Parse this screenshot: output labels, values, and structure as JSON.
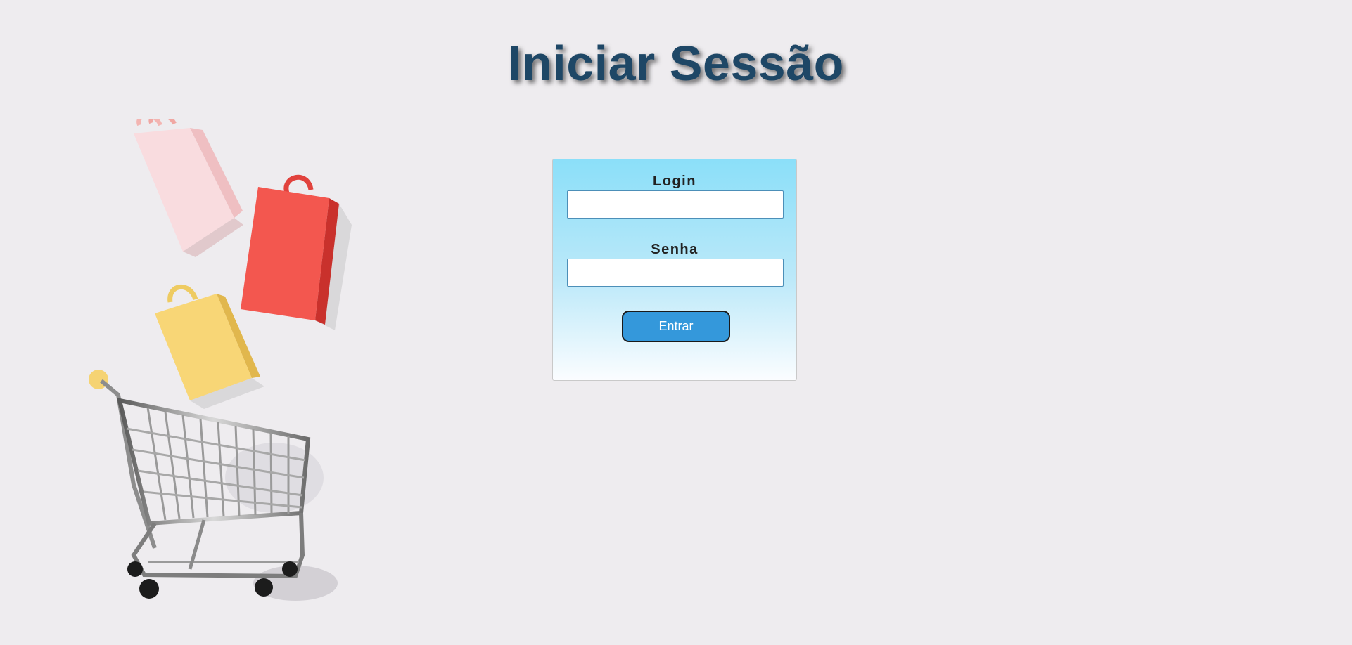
{
  "page": {
    "title": "Iniciar Sessão"
  },
  "illustration": {
    "description_icon": "shopping-cart-with-bags"
  },
  "login_form": {
    "login_label": "Login",
    "login_value": "",
    "senha_label": "Senha",
    "senha_value": "",
    "submit_label": "Entrar"
  },
  "colors": {
    "background": "#eeecef",
    "title": "#1e4766",
    "card_gradient_top": "#8bdff9",
    "card_gradient_bottom": "#fbfdff",
    "button": "#3498db",
    "bag_pink": "#f6d0d3",
    "bag_red": "#f2574f",
    "bag_yellow": "#f7d374"
  }
}
